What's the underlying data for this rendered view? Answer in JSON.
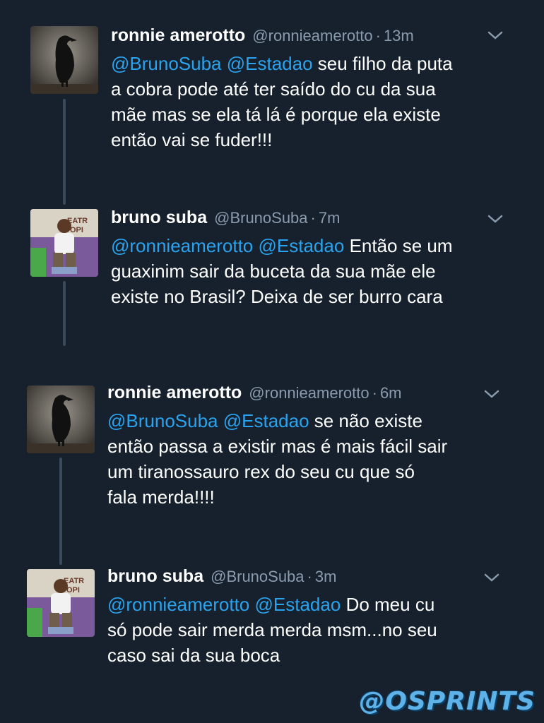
{
  "tweets": [
    {
      "name": "ronnie amerotto",
      "handle": "@ronnieamerotto",
      "separator": "·",
      "time": "13m",
      "avatar_icon": "crow-avatar",
      "mentions": [
        "@BrunoSuba",
        "@Estadao"
      ],
      "lines": [
        "seu filho da puta",
        "a cobra pode até ter saído do cu da sua",
        "mãe mas se ela tá lá é porque ela existe",
        "então vai se fuder!!!"
      ]
    },
    {
      "name": "bruno suba",
      "handle": "@BrunoSuba",
      "separator": "·",
      "time": "7m",
      "avatar_icon": "person-photo-avatar",
      "mentions": [
        "@ronnieamerotto",
        "@Estadao"
      ],
      "lines": [
        "Então se um",
        "guaxinim sair da buceta da sua mãe ele",
        "existe no Brasil? Deixa de ser burro cara"
      ]
    },
    {
      "name": "ronnie amerotto",
      "handle": "@ronnieamerotto",
      "separator": "·",
      "time": "6m",
      "avatar_icon": "crow-avatar",
      "mentions": [
        "@BrunoSuba",
        "@Estadao"
      ],
      "lines": [
        "se não existe",
        "então passa a existir mas é mais fácil sair",
        "um tiranossauro rex do seu cu que só",
        "fala merda!!!!"
      ]
    },
    {
      "name": "bruno suba",
      "handle": "@BrunoSuba",
      "separator": "·",
      "time": "3m",
      "avatar_icon": "person-photo-avatar",
      "mentions": [
        "@ronnieamerotto",
        "@Estadao"
      ],
      "lines": [
        "Do meu cu",
        "só pode sair merda merda msm...no seu",
        "caso sai da sua boca"
      ]
    }
  ],
  "watermark": "@OSPRINTS",
  "colors": {
    "background": "#16212d",
    "mention": "#2aa3ef",
    "secondary": "#8a9bad",
    "thread_line": "#3a4a5e"
  }
}
